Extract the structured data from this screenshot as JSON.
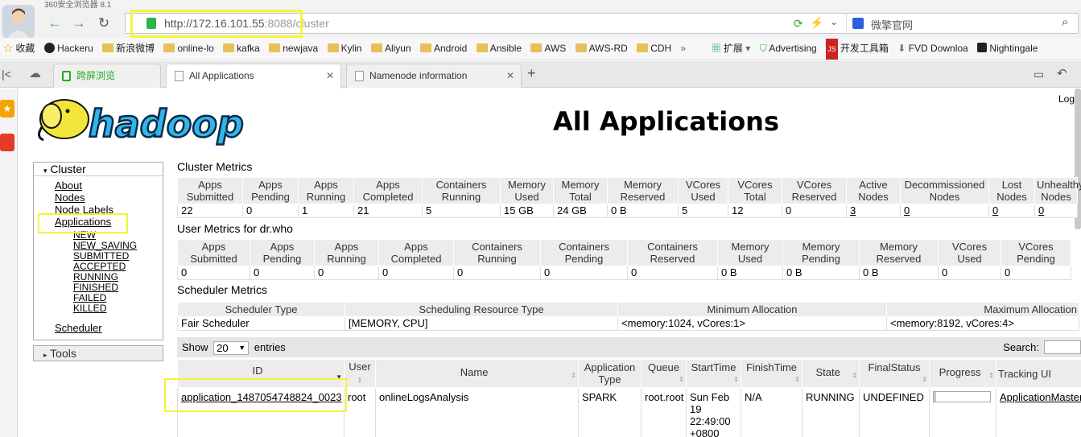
{
  "browser": {
    "title_strip": "360安全浏览器 8.1",
    "url_host": "http://172.16.101.55",
    "url_port": ":8088",
    "url_path": "/cluster",
    "search_placeholder": "微擎官网"
  },
  "bookmarks": [
    {
      "label": "收藏",
      "icon": "star-icon"
    },
    {
      "label": "Hackeru",
      "icon": "github-icon"
    },
    {
      "label": "新浪微博",
      "icon": "folder-icon"
    },
    {
      "label": "online-lo",
      "icon": "folder-icon"
    },
    {
      "label": "kafka",
      "icon": "folder-icon"
    },
    {
      "label": "newjava",
      "icon": "folder-icon"
    },
    {
      "label": "Kylin",
      "icon": "folder-icon"
    },
    {
      "label": "Aliyun",
      "icon": "folder-icon"
    },
    {
      "label": "Android",
      "icon": "folder-icon"
    },
    {
      "label": "Ansible",
      "icon": "folder-icon"
    },
    {
      "label": "AWS",
      "icon": "folder-icon"
    },
    {
      "label": "AWS-RD",
      "icon": "folder-icon"
    },
    {
      "label": "CDH",
      "icon": "folder-icon"
    },
    {
      "label": "»",
      "icon": ""
    },
    {
      "label": "扩展",
      "icon": "puzzle-icon"
    },
    {
      "label": "Advertising",
      "icon": "shield-icon"
    },
    {
      "label": "开发工具箱",
      "icon": "js-icon"
    },
    {
      "label": "FVD Downloa",
      "icon": "download-icon"
    },
    {
      "label": "Nightingale",
      "icon": "bird-icon"
    }
  ],
  "tabs": [
    {
      "label": "跨屏浏览",
      "active": false
    },
    {
      "label": "All Applications",
      "active": true
    },
    {
      "label": "Namenode information",
      "active": false
    }
  ],
  "page": {
    "logo_text": "hadoop",
    "title": "All Applications",
    "login": "Log"
  },
  "nav": {
    "cluster_label": "Cluster",
    "links": [
      "About",
      "Nodes",
      "Node Labels",
      "Applications"
    ],
    "states": [
      "NEW",
      "NEW_SAVING",
      "SUBMITTED",
      "ACCEPTED",
      "RUNNING",
      "FINISHED",
      "FAILED",
      "KILLED"
    ],
    "scheduler": "Scheduler",
    "tools_label": "Tools"
  },
  "cluster_metrics": {
    "heading": "Cluster Metrics",
    "headers": [
      "Apps Submitted",
      "Apps Pending",
      "Apps Running",
      "Apps Completed",
      "Containers Running",
      "Memory Used",
      "Memory Total",
      "Memory Reserved",
      "VCores Used",
      "VCores Total",
      "VCores Reserved",
      "Active Nodes",
      "Decommissioned Nodes",
      "Lost Nodes",
      "Unhealthy Nodes"
    ],
    "values": [
      "22",
      "0",
      "1",
      "21",
      "5",
      "15 GB",
      "24 GB",
      "0 B",
      "5",
      "12",
      "0",
      "3",
      "0",
      "0",
      "0"
    ]
  },
  "user_metrics": {
    "heading": "User Metrics for dr.who",
    "headers": [
      "Apps Submitted",
      "Apps Pending",
      "Apps Running",
      "Apps Completed",
      "Containers Running",
      "Containers Pending",
      "Containers Reserved",
      "Memory Used",
      "Memory Pending",
      "Memory Reserved",
      "VCores Used",
      "VCores Pending"
    ],
    "values": [
      "0",
      "0",
      "0",
      "0",
      "0",
      "0",
      "0",
      "0 B",
      "0 B",
      "0 B",
      "0",
      "0"
    ]
  },
  "scheduler_metrics": {
    "heading": "Scheduler Metrics",
    "headers": [
      "Scheduler Type",
      "Scheduling Resource Type",
      "Minimum Allocation",
      "Maximum Allocation"
    ],
    "values": [
      "Fair Scheduler",
      "[MEMORY, CPU]",
      "<memory:1024, vCores:1>",
      "<memory:8192, vCores:4>"
    ]
  },
  "apps_table": {
    "show_label": "Show",
    "show_value": "20",
    "entries_label": "entries",
    "search_label": "Search:",
    "headers": [
      "ID",
      "User",
      "Name",
      "Application Type",
      "Queue",
      "StartTime",
      "FinishTime",
      "State",
      "FinalStatus",
      "Progress",
      "Tracking UI"
    ],
    "row": {
      "id": "application_1487054748824_0023",
      "user": "root",
      "name": "onlineLogsAnalysis",
      "type": "SPARK",
      "queue": "root.root",
      "start_l1": "Sun Feb",
      "start_l2": "19",
      "start_l3": "22:49:00",
      "start_l4": "+0800",
      "finish": "N/A",
      "state": "RUNNING",
      "final": "UNDEFINED",
      "progress": 0.04,
      "tracking": "ApplicationMaster"
    }
  }
}
